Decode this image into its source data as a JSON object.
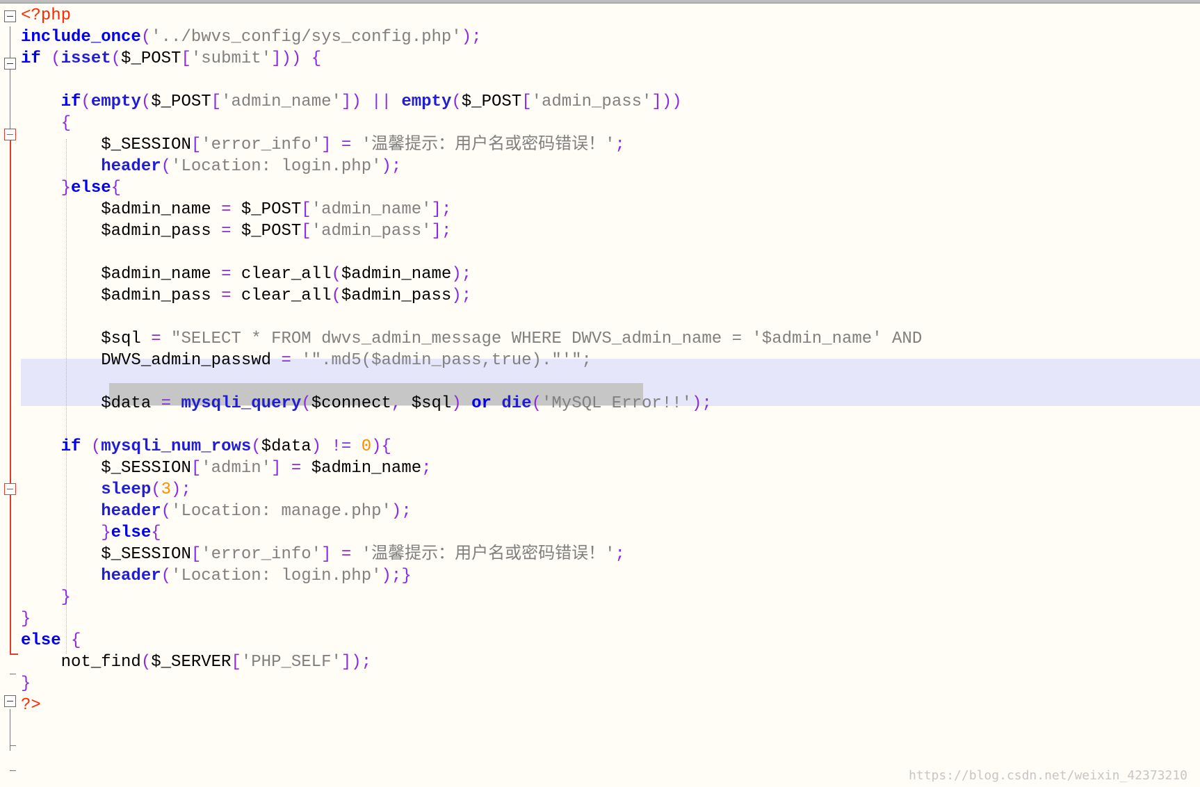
{
  "editor": {
    "language": "php",
    "lines": [
      "<?php",
      "include_once('../bwvs_config/sys_config.php');",
      "if (isset($_POST['submit'])) {",
      "",
      "    if(empty($_POST['admin_name']) || empty($_POST['admin_pass']))",
      "    {",
      "        $_SESSION['error_info'] = '温馨提示：用户名或密码错误！';",
      "        header('Location: login.php');",
      "    }else{",
      "        $admin_name = $_POST['admin_name'];",
      "        $admin_pass = $_POST['admin_pass'];",
      "",
      "        $admin_name = clear_all($admin_name);",
      "        $admin_pass = clear_all($admin_pass);",
      "",
      "        $sql = \"SELECT * FROM dwvs_admin_message WHERE DWVS_admin_name = '$admin_name' AND",
      "        DWVS_admin_passwd = '\".md5($admin_pass,true).\"'\";",
      "",
      "        $data = mysqli_query($connect, $sql) or die('MySQL Error!!');",
      "",
      "    if (mysqli_num_rows($data) != 0){",
      "        $_SESSION['admin'] = $admin_name;",
      "        sleep(3);",
      "        header('Location: manage.php');",
      "        }else{",
      "        $_SESSION['error_info'] = '温馨提示：用户名或密码错误！';",
      "        header('Location: login.php');}",
      "    }",
      "}",
      "else {",
      "    not_find($_SERVER['PHP_SELF']);",
      "}",
      "?>"
    ]
  },
  "watermark": "https://blog.csdn.net/weixin_42373210"
}
